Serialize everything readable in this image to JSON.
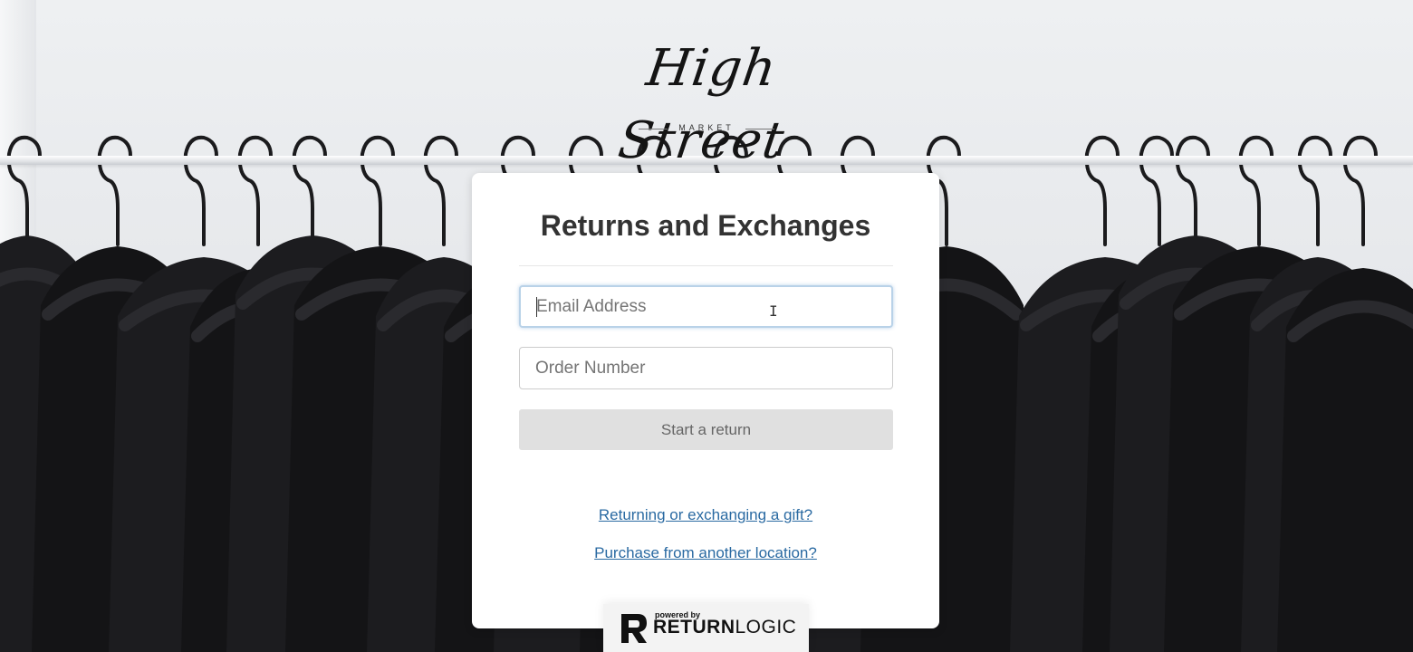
{
  "brand": {
    "name": "High Street",
    "subtitle": "MARKET"
  },
  "card": {
    "title": "Returns and Exchanges",
    "email": {
      "placeholder": "Email Address",
      "value": ""
    },
    "order": {
      "placeholder": "Order Number",
      "value": ""
    },
    "start_button": "Start a return",
    "links": {
      "gift": "Returning or exchanging a gift?",
      "location": "Purchase from another location?"
    }
  },
  "powered_by": {
    "prefix": "powered by",
    "name_bold": "RETURN",
    "name_light": "LOGIC"
  },
  "colors": {
    "link": "#2a6aa2",
    "button_bg": "#e0e0e0",
    "focus_border": "#b9d2e8"
  }
}
